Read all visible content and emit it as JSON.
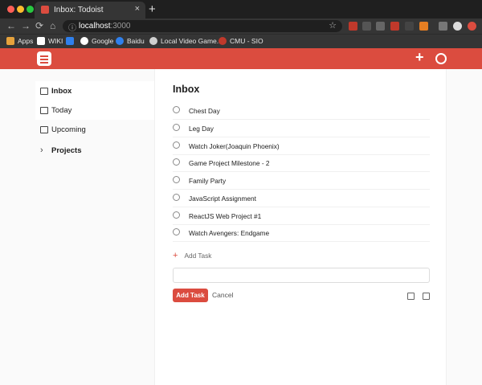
{
  "browser": {
    "tab_title": "Inbox: Todoist",
    "tab_close": "×",
    "new_tab": "+",
    "url_host": "localhost",
    "url_port": ":3000",
    "bookmarks": [
      "Apps",
      "WIKI",
      "Google",
      "Baidu",
      "Local Video Game...",
      "CMU - SIO"
    ],
    "traffic_colors": [
      "#ff5f57",
      "#febc2e",
      "#28c840"
    ]
  },
  "app": {
    "accent": "#db4c3f",
    "add_icon": "plus-icon",
    "feed_icon": "rss-icon"
  },
  "sidebar": {
    "items": [
      {
        "label": "Inbox",
        "icon": "inbox-icon"
      },
      {
        "label": "Today",
        "icon": "calendar-icon"
      },
      {
        "label": "Upcoming",
        "icon": "calendar-grid-icon"
      },
      {
        "label": "Projects",
        "icon": "chevron-right-icon"
      }
    ]
  },
  "main": {
    "title": "Inbox",
    "tasks": [
      "Chest Day",
      "Leg Day",
      "Watch Joker(Joaquin Phoenix)",
      "Game Project Milestone - 2",
      "Family Party",
      "JavaScript Assignment",
      "ReactJS Web Project #1",
      "Watch Avengers: Endgame"
    ],
    "add_task_label": "Add Task",
    "add_task_plus": "+",
    "input_value": "",
    "submit_label": "Add Task",
    "cancel_label": "Cancel"
  }
}
